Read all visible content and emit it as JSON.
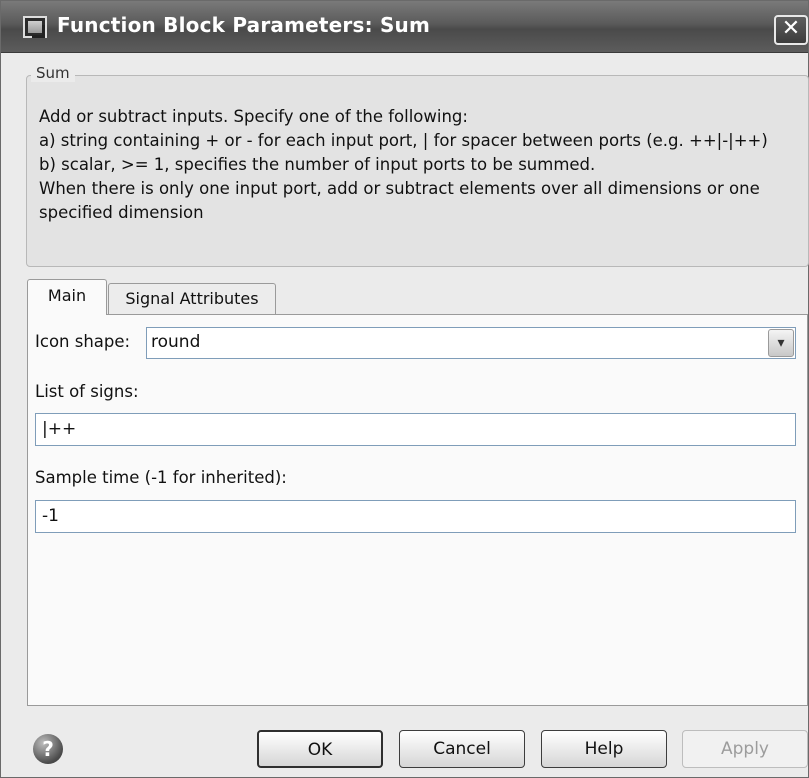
{
  "window": {
    "title": "Function Block Parameters: Sum",
    "close_label": "✕"
  },
  "group": {
    "legend": "Sum",
    "description": [
      "Add or subtract inputs.  Specify one of the following:",
      "a) string containing + or - for each input port, | for spacer between ports (e.g. ++|-|++)",
      "b) scalar, >= 1, specifies the number of input ports to be summed.",
      "When there is only one input port, add or subtract elements over all dimensions or one",
      "specified dimension"
    ]
  },
  "tabs": [
    {
      "label": "Main",
      "active": true
    },
    {
      "label": "Signal Attributes",
      "active": false
    }
  ],
  "params": {
    "icon_shape": {
      "label": "Icon shape:",
      "value": "round"
    },
    "list_of_signs": {
      "label": "List of signs:",
      "value": "|++"
    },
    "sample_time": {
      "label": "Sample time (-1 for inherited):",
      "value": "-1"
    }
  },
  "buttons": {
    "help_icon": "?",
    "ok": "OK",
    "cancel": "Cancel",
    "help": "Help",
    "apply": "Apply"
  },
  "icons": {
    "app": "simulink-block-icon",
    "close": "close-icon",
    "dropdown": "chevron-down-icon",
    "help": "help-circle-icon"
  }
}
